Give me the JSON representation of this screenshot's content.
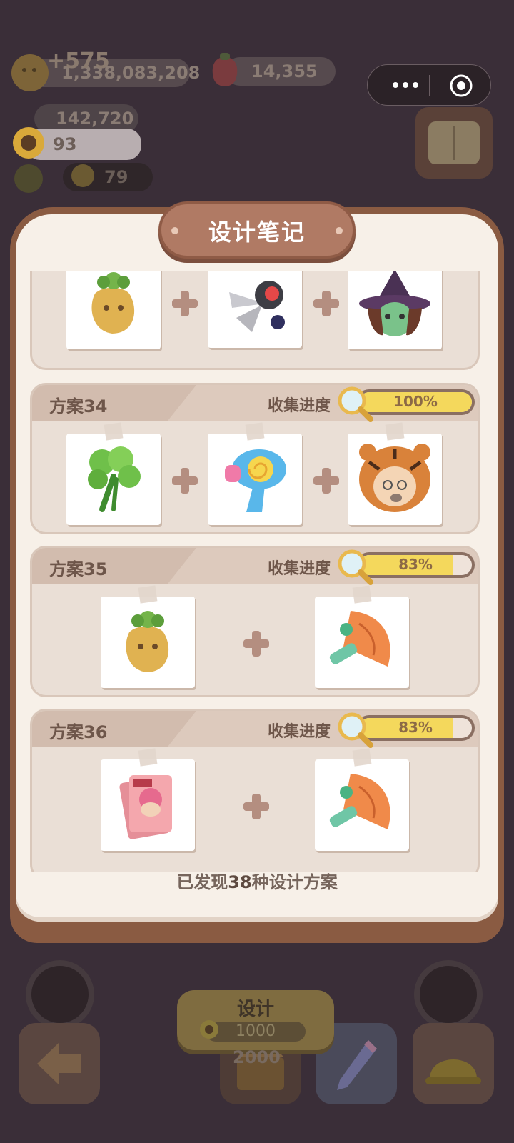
{
  "hud": {
    "gold_delta": "+575",
    "gold_value": "1,338,083,208",
    "berry_value": "14,355",
    "gem_value": "142,720",
    "sunflower_value": "93",
    "cat_value": "79"
  },
  "modal": {
    "title": "设计笔记",
    "plans": [
      {
        "name": "方案34",
        "progress_label": "收集进度",
        "progress_text": "100%",
        "progress": 1.0,
        "items": [
          "vegetable-bunch",
          "spiral-water-gun",
          "tiger-hood-character"
        ]
      },
      {
        "name": "方案35",
        "progress_label": "收集进度",
        "progress_text": "83%",
        "progress": 0.83,
        "items": [
          "mandrake-root",
          "dragon-cleaver"
        ]
      },
      {
        "name": "方案36",
        "progress_label": "收集进度",
        "progress_text": "83%",
        "progress": 0.83,
        "items": [
          "yep-card-stack",
          "dragon-cleaver"
        ]
      }
    ],
    "partial_plan_items": [
      "mandrake-root",
      "scissors-gadget",
      "witch-hat-character"
    ],
    "footer_prefix": "已发现",
    "footer_count": "38",
    "footer_suffix": "种设计方案"
  },
  "bottom": {
    "design_label": "设计",
    "design_cost": "1000",
    "extra_cost": "2000"
  },
  "colors": {
    "frame": "#8a5b42",
    "panel": "#f7f0e8",
    "progress_fill": "#f4d85c"
  }
}
